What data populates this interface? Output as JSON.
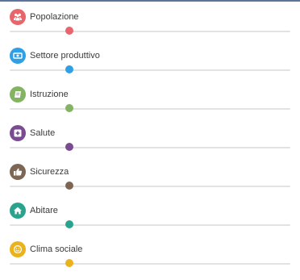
{
  "panel": {
    "items": [
      {
        "label": "Popolazione",
        "color": "#e8666b",
        "knob_color": "#e8666b",
        "icon": "people-icon",
        "slider_value": 0.214
      },
      {
        "label": "Settore produttivo",
        "color": "#2f9fe6",
        "knob_color": "#2f9fe6",
        "icon": "money-icon",
        "slider_value": 0.214
      },
      {
        "label": "Istruzione",
        "color": "#83b462",
        "knob_color": "#83b462",
        "icon": "book-icon",
        "slider_value": 0.214
      },
      {
        "label": "Salute",
        "color": "#7a4b91",
        "knob_color": "#7a4b91",
        "icon": "health-cross-icon",
        "slider_value": 0.214
      },
      {
        "label": "Sicurezza",
        "color": "#7e6655",
        "knob_color": "#7e6655",
        "icon": "thumbs-up-icon",
        "slider_value": 0.214
      },
      {
        "label": "Abitare",
        "color": "#2aa38c",
        "knob_color": "#2aa38c",
        "icon": "home-icon",
        "slider_value": 0.214
      },
      {
        "label": "Clima sociale",
        "color": "#eab21c",
        "knob_color": "#eab21c",
        "icon": "smile-icon",
        "slider_value": 0.214
      }
    ]
  }
}
